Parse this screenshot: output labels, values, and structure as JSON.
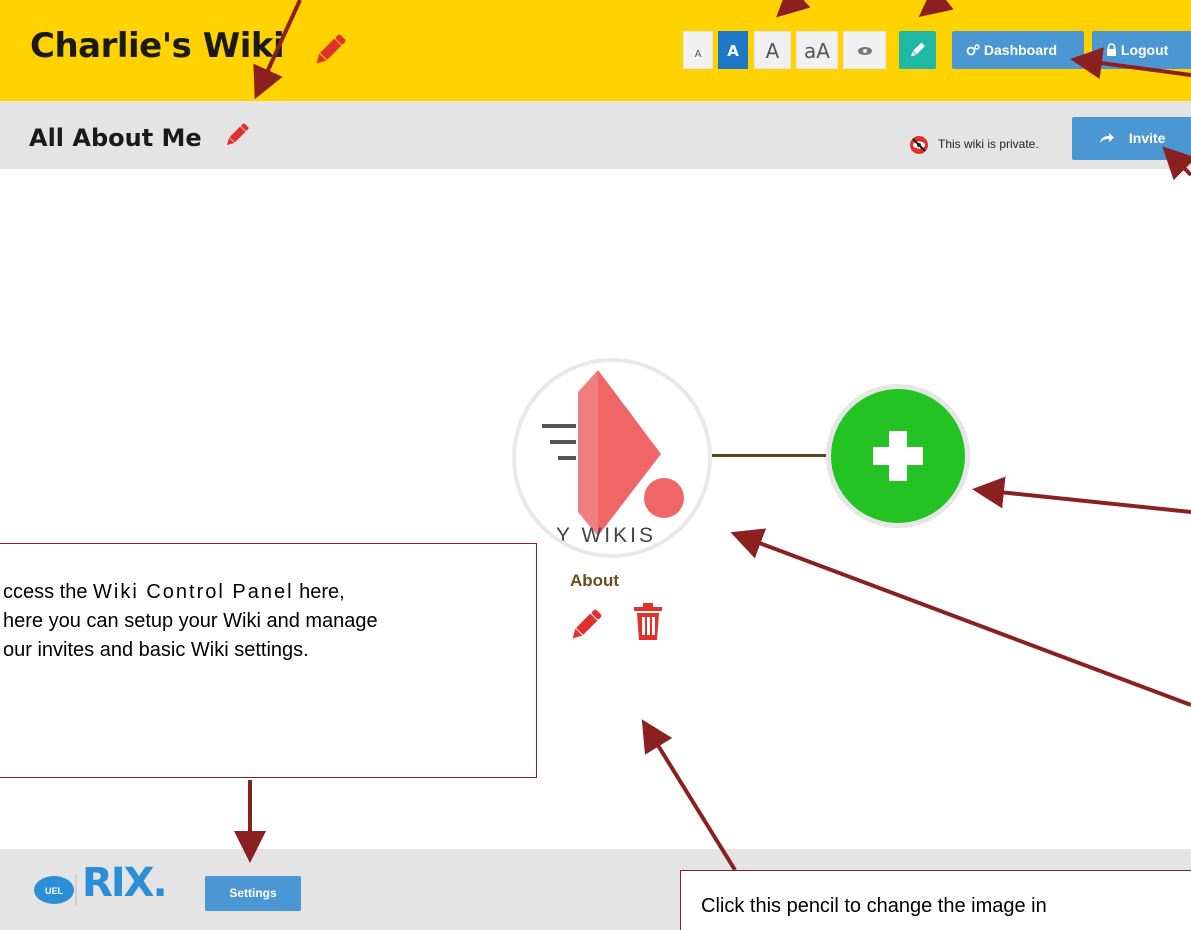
{
  "header": {
    "wiki_title": "Charlie's Wiki",
    "font_sizes": [
      "A",
      "A",
      "A",
      "aA"
    ],
    "dashboard_label": "Dashboard",
    "logout_label": "Logout"
  },
  "subheader": {
    "page_title": "All About Me",
    "privacy_text": "This wiki is private.",
    "invite_label": "Invite"
  },
  "node": {
    "logo_text": "Y WIKIS",
    "label": "About"
  },
  "callout": {
    "text_before": "ccess the ",
    "text_emphasis": "Wiki Control Panel",
    "text_after": " here,",
    "line2": "here you can setup your Wiki and manage",
    "line3": "our invites and basic Wiki settings."
  },
  "footer": {
    "settings_label": "Settings",
    "logo_text": "RIX."
  },
  "callout2": {
    "text": "Click this pencil to change the image in"
  },
  "colors": {
    "header_bg": "#ffd200",
    "button_blue": "#4a97d4",
    "add_green": "#23c323",
    "pencil_red": "#e0312e",
    "annotation_red": "#8b2020"
  }
}
